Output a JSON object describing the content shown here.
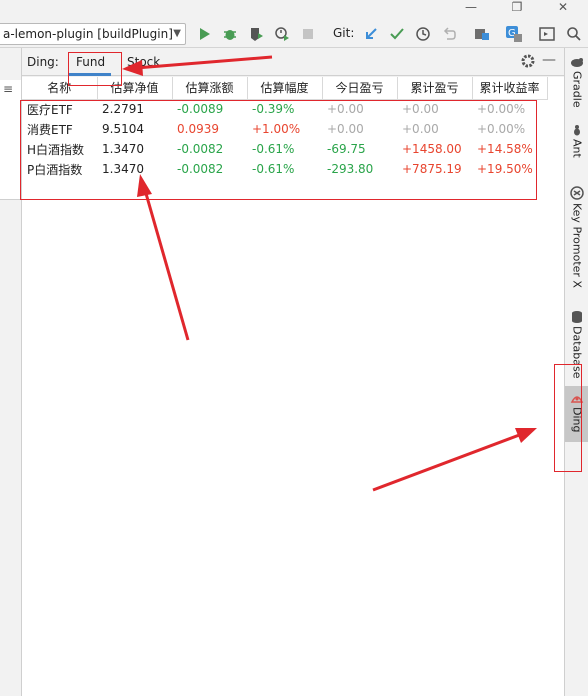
{
  "titlebar": {
    "minimize_icon": "minimize-icon",
    "restore_icon": "restore-icon",
    "close_icon": "close-icon"
  },
  "toolbar": {
    "run_config": "a-lemon-plugin [buildPlugin]",
    "git_label": "Git:",
    "icons": [
      "run-icon",
      "debug-icon",
      "coverage-icon",
      "profile-icon",
      "stop-icon",
      "git-update-icon",
      "git-commit-icon",
      "history-icon",
      "rollback-icon",
      "project-structure-icon",
      "translate-icon",
      "terminal-icon",
      "search-icon"
    ],
    "colors": {
      "run": "#499c54",
      "debug": "#499c54",
      "git_update": "#3d8ed8",
      "git_commit": "#499c54"
    }
  },
  "panel": {
    "title": "Ding:",
    "tabs": [
      {
        "label": "Fund",
        "active": true
      },
      {
        "label": "Stock",
        "active": false
      }
    ]
  },
  "table": {
    "headers": [
      "名称",
      "估算净值",
      "估算涨额",
      "估算幅度",
      "今日盈亏",
      "累计盈亏",
      "累计收益率"
    ],
    "rows": [
      {
        "name": "医疗ETF",
        "nav": "2.2791",
        "change": "-0.0089",
        "pct": "-0.39%",
        "today": "+0.00",
        "total": "+0.00",
        "rate": "+0.00%"
      },
      {
        "name": "消费ETF",
        "nav": "9.5104",
        "change": "0.0939",
        "pct": "+1.00%",
        "today": "+0.00",
        "total": "+0.00",
        "rate": "+0.00%"
      },
      {
        "name": "H白酒指数",
        "nav": "1.3470",
        "change": "-0.0082",
        "pct": "-0.61%",
        "today": "-69.75",
        "total": "+1458.00",
        "rate": "+14.58%"
      },
      {
        "name": "P白酒指数",
        "nav": "1.3470",
        "change": "-0.0082",
        "pct": "-0.61%",
        "today": "-293.80",
        "total": "+7875.19",
        "rate": "+19.50%"
      }
    ],
    "colors": {
      "up": "#e8452f",
      "down": "#2aa44a",
      "neutral": "#a9a9a9",
      "text": "#222222"
    }
  },
  "right_sidebar": {
    "tabs": [
      {
        "label": "Gradle",
        "icon": "gradle-icon",
        "active": false
      },
      {
        "label": "Ant",
        "icon": "ant-icon",
        "active": false
      },
      {
        "label": "Key Promoter X",
        "icon": "key-promoter-icon",
        "active": false
      },
      {
        "label": "Database",
        "icon": "database-icon",
        "active": false
      },
      {
        "label": "Ding",
        "icon": "ding-icon",
        "active": true
      }
    ]
  },
  "annotation_color": "#e0272d"
}
